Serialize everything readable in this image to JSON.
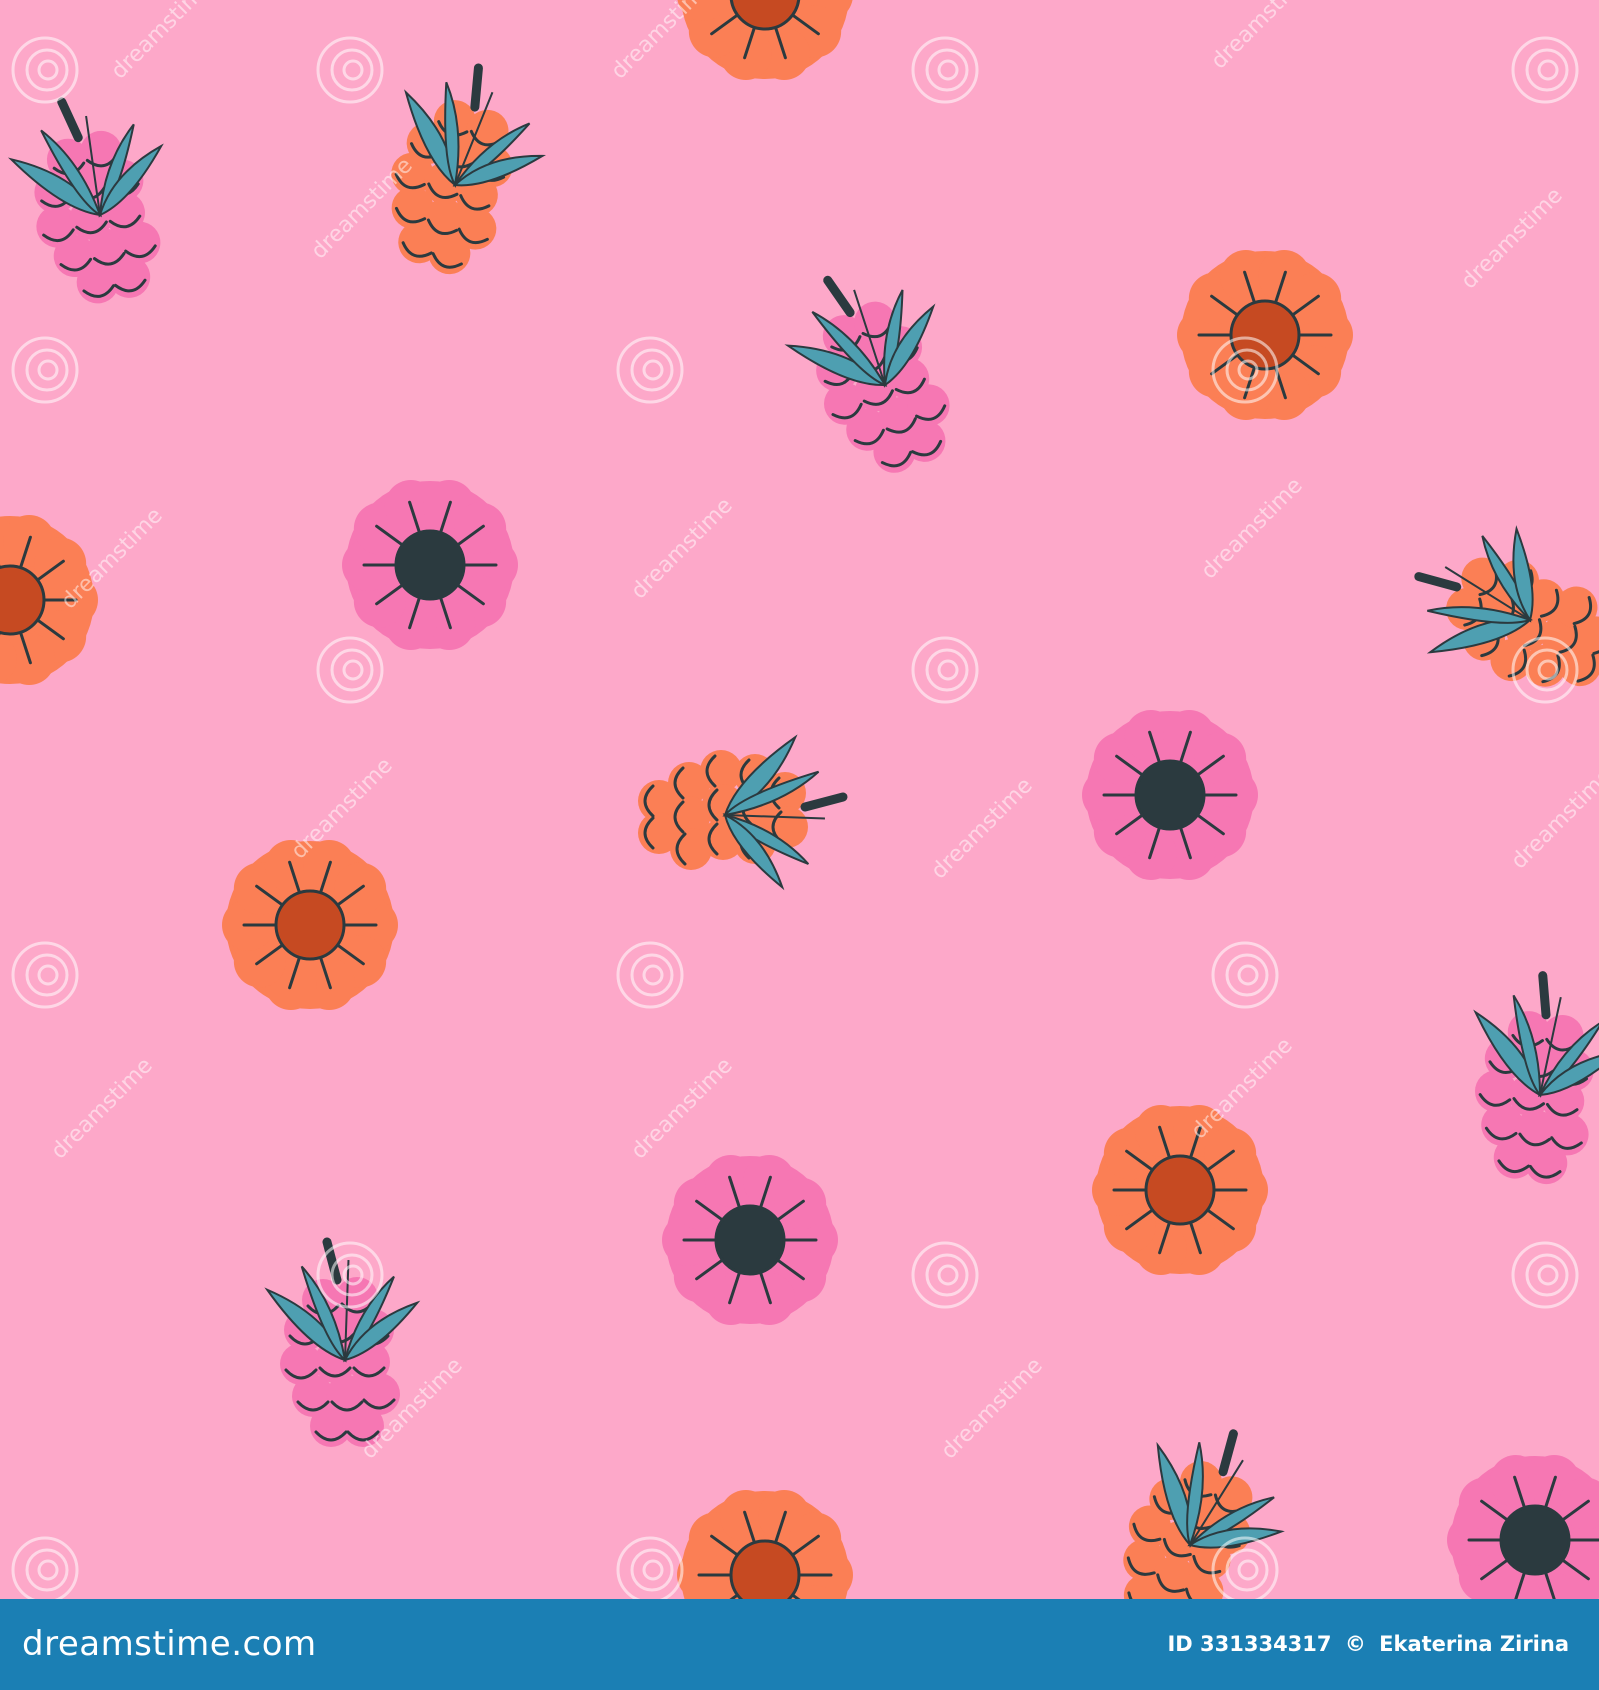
{
  "colors": {
    "background": "#fda8c9",
    "outline": "#2b3a3f",
    "berry_pink": "#f677b3",
    "berry_pink_shadow": "#f45aa3",
    "berry_orange": "#fb7f55",
    "berry_orange_inner": "#c64a22",
    "leaf_teal": "#4e9fb1",
    "footer": "#1b7fb4"
  },
  "watermark": {
    "text": "dreamstime",
    "icon": "spiral-logo-icon"
  },
  "footer": {
    "logo_text": "dreamstime.com",
    "image_id": "ID 331334317",
    "copyright_symbol": "©",
    "author": "Ekaterina Zirina"
  }
}
